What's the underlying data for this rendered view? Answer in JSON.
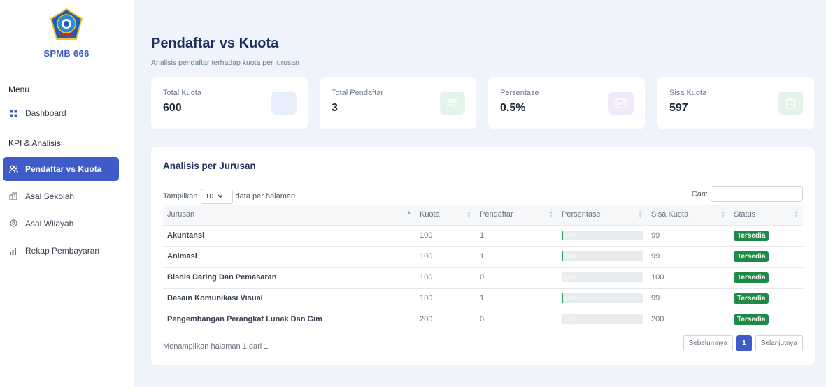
{
  "sidebar": {
    "brand": "SPMB 666",
    "menu_heading": "Menu",
    "kpi_heading": "KPI & Analisis",
    "items": [
      {
        "label": "Dashboard",
        "icon": "grid-icon"
      },
      {
        "label": "Pendaftar vs Kuota",
        "icon": "users-icon",
        "active": true
      },
      {
        "label": "Asal Sekolah",
        "icon": "building-icon"
      },
      {
        "label": "Asal Wilayah",
        "icon": "location-pin-icon"
      },
      {
        "label": "Rekap Pembayaran",
        "icon": "bar-chart-icon"
      }
    ]
  },
  "header": {
    "title": "Pendaftar vs Kuota",
    "subtitle": "Analisis pendaftar terhadap kuota per jurusan"
  },
  "stats": [
    {
      "label": "Total Kuota",
      "value": "600",
      "icon": "blank-icon",
      "color": "#e6eefc"
    },
    {
      "label": "Total Pendaftar",
      "value": "3",
      "icon": "users-icon",
      "color": "#e3f4ea"
    },
    {
      "label": "Persentase",
      "value": "0.5%",
      "icon": "trend-icon",
      "color": "#f1e8fb"
    },
    {
      "label": "Sisa Kuota",
      "value": "597",
      "icon": "clipboard-icon",
      "color": "#e3f4ea"
    }
  ],
  "panel": {
    "title": "Analisis per Jurusan",
    "show_label": "Tampilkan",
    "page_size": "10",
    "per_page_label": "data per halaman",
    "search_label": "Cari:",
    "search_value": "",
    "columns": [
      "Jurusan",
      "Kuota",
      "Pendaftar",
      "Persentase",
      "Sisa Kuota",
      "Status"
    ],
    "rows": [
      {
        "jurusan": "Akuntansi",
        "kuota": "100",
        "pendaftar": "1",
        "persen_label": "1.0%",
        "persen": 1,
        "sisa": "99",
        "status": "Tersedia"
      },
      {
        "jurusan": "Animasi",
        "kuota": "100",
        "pendaftar": "1",
        "persen_label": "1.0%",
        "persen": 1,
        "sisa": "99",
        "status": "Tersedia"
      },
      {
        "jurusan": "Bisnis Daring Dan Pemasaran",
        "kuota": "100",
        "pendaftar": "0",
        "persen_label": "0.0%",
        "persen": 0,
        "sisa": "100",
        "status": "Tersedia"
      },
      {
        "jurusan": "Desain Komunikasi Visual",
        "kuota": "100",
        "pendaftar": "1",
        "persen_label": "1.0%",
        "persen": 1,
        "sisa": "99",
        "status": "Tersedia"
      },
      {
        "jurusan": "Pengembangan Perangkat Lunak Dan Gim",
        "kuota": "200",
        "pendaftar": "0",
        "persen_label": "0.0%",
        "persen": 0,
        "sisa": "200",
        "status": "Tersedia"
      }
    ],
    "info": "Menampilkan halaman 1 dari 1",
    "prev_label": "Sebelumnya",
    "current_page": "1",
    "next_label": "Selanjutnya"
  },
  "colors": {
    "accent": "#3f5bc7",
    "status_available": "#1d8a46",
    "progress": "#22a55b"
  }
}
